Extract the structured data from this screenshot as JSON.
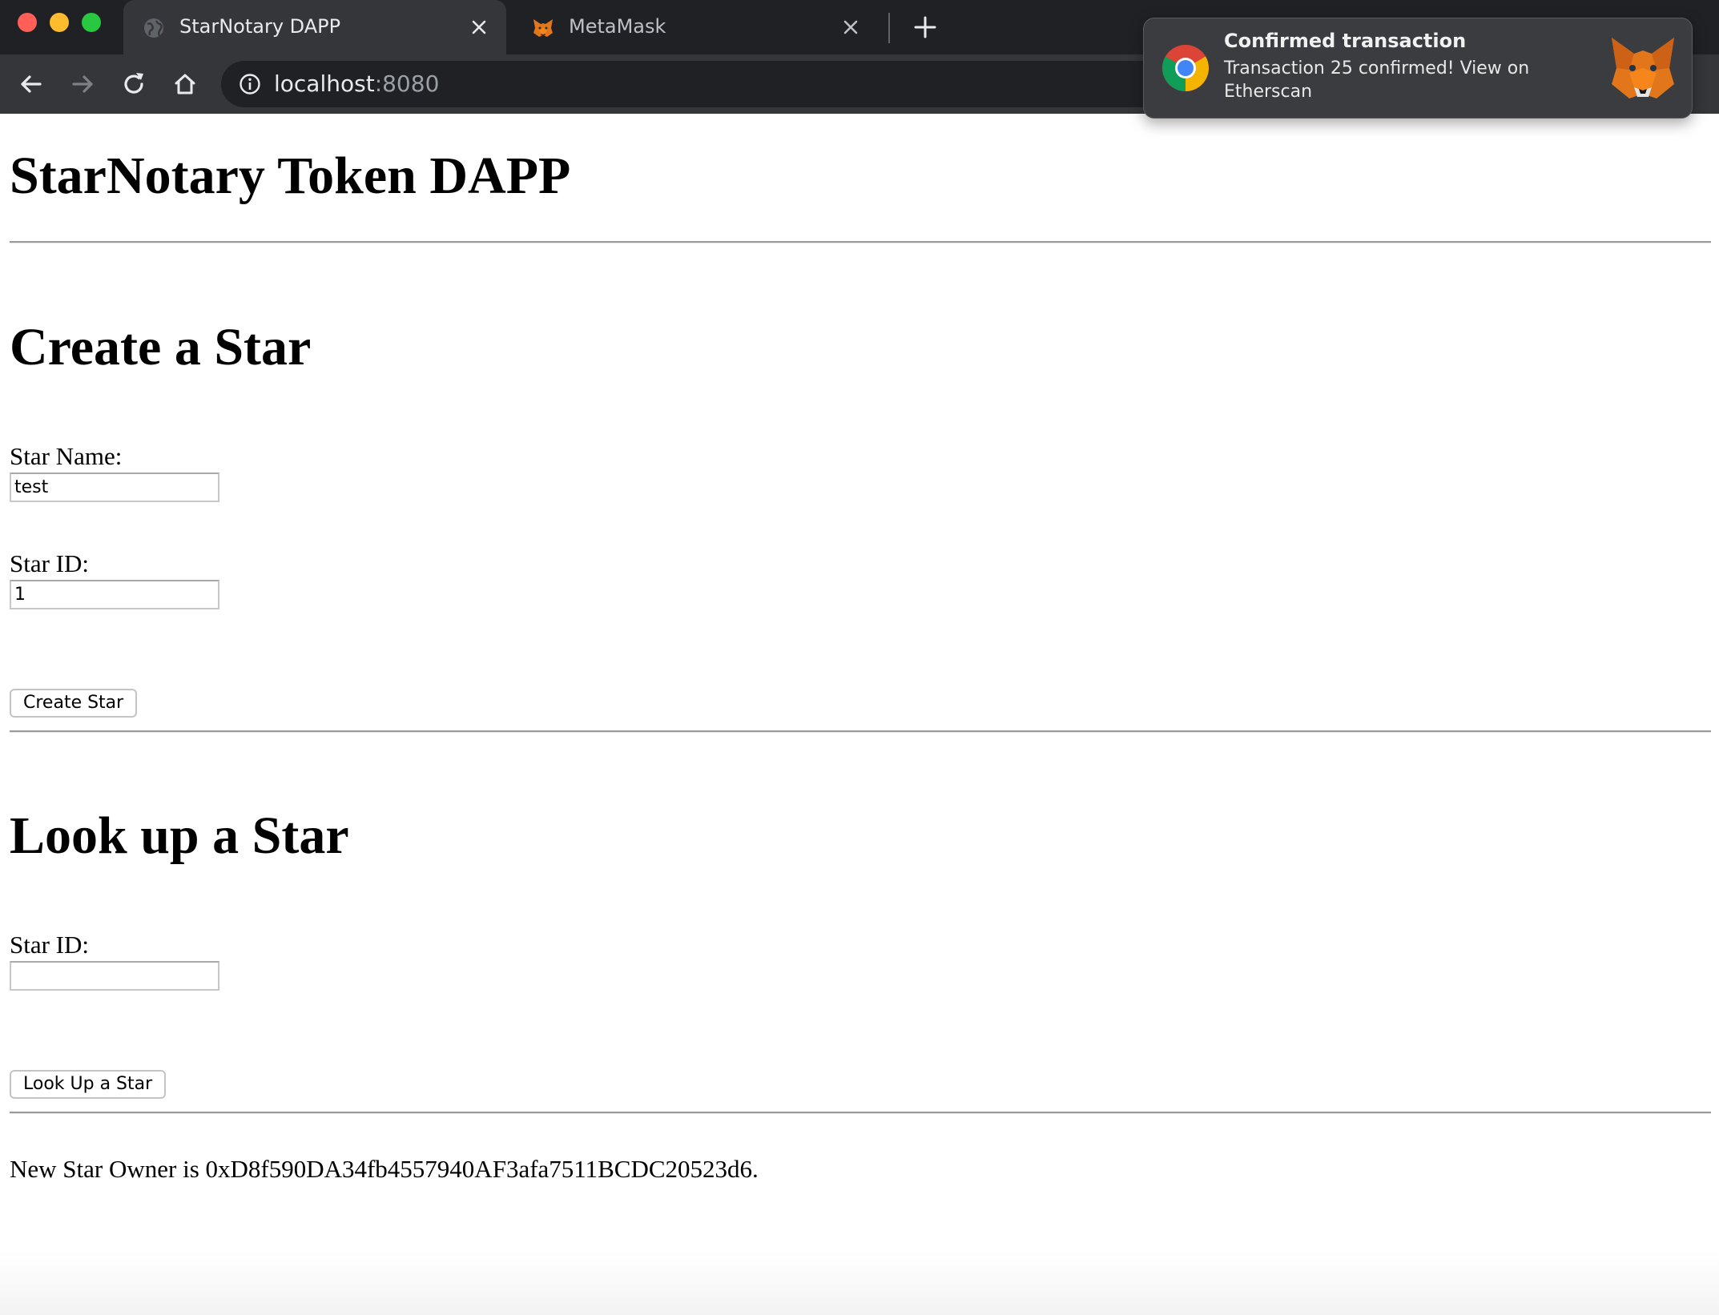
{
  "browser": {
    "tabs": [
      {
        "title": "StarNotary DAPP",
        "active": true
      },
      {
        "title": "MetaMask",
        "active": false
      }
    ],
    "address": {
      "host": "localhost",
      "port": ":8080"
    }
  },
  "notification": {
    "title": "Confirmed transaction",
    "body": "Transaction 25 confirmed! View on Etherscan"
  },
  "page": {
    "title": "StarNotary Token DAPP",
    "create": {
      "heading": "Create a Star",
      "name_label": "Star Name:",
      "name_value": "test",
      "id_label": "Star ID:",
      "id_value": "1",
      "button_label": "Create Star"
    },
    "lookup": {
      "heading": "Look up a Star",
      "id_label": "Star ID:",
      "id_value": "",
      "button_label": "Look Up a Star"
    },
    "status": "New Star Owner is 0xD8f590DA34fb4557940AF3afa7511BCDC20523d6."
  },
  "colors": {
    "chrome_dark": "#202124",
    "chrome_toolbar": "#35363a",
    "notification_bg": "#3b3c3f",
    "metamask_orange": "#e2761b"
  }
}
